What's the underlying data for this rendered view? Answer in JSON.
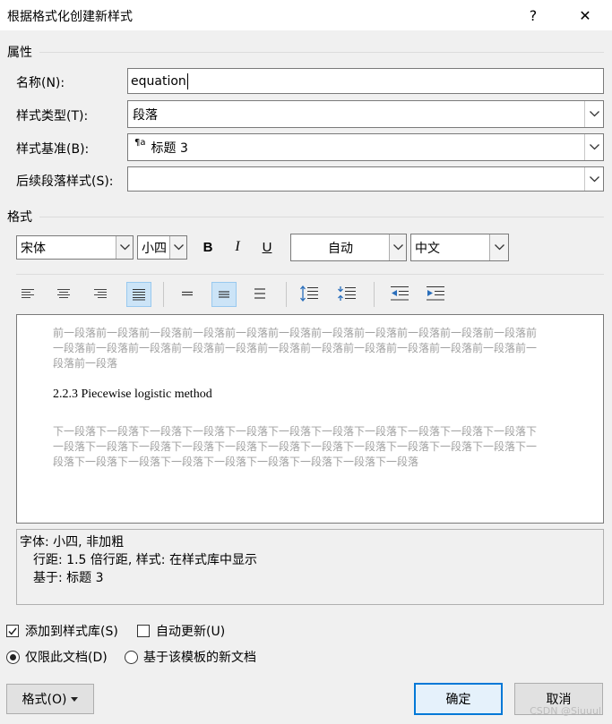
{
  "window": {
    "title": "根据格式化创建新样式",
    "help": "?",
    "close": "✕"
  },
  "properties": {
    "section_label": "属性",
    "name": {
      "label": "名称(N):",
      "value": "equation"
    },
    "style_type": {
      "label": "样式类型(T):",
      "value": "段落"
    },
    "style_based": {
      "label": "样式基准(B):",
      "value": "标题 3",
      "icon_text": "¶a"
    },
    "next_style": {
      "label": "后续段落样式(S):",
      "value": ""
    }
  },
  "format": {
    "section_label": "格式",
    "font": "宋体",
    "size": "小四",
    "bold": "B",
    "italic": "I",
    "underline": "U",
    "color": "自动",
    "script": "中文"
  },
  "preview": {
    "prev_para": "前一段落前一段落前一段落前一段落前一段落前一段落前一段落前一段落前一段落前一段落前一段落前一段落前一段落前一段落前一段落前一段落前一段落前一段落前一段落前一段落前一段落前一段落前一段落前一段落",
    "sample": "2.2.3 Piecewise logistic method",
    "next_para": "下一段落下一段落下一段落下一段落下一段落下一段落下一段落下一段落下一段落下一段落下一段落下一段落下一段落下一段落下一段落下一段落下一段落下一段落下一段落下一段落下一段落下一段落下一段落下一段落下一段落下一段落下一段落下一段落下一段落下一段落下一段落"
  },
  "description": {
    "line1": "字体: 小四, 非加粗",
    "line2": "行距: 1.5 倍行距, 样式: 在样式库中显示",
    "line3": "基于: 标题 3"
  },
  "options": {
    "add_to_gallery": "添加到样式库(S)",
    "add_to_gallery_checked": true,
    "auto_update": "自动更新(U)",
    "auto_update_checked": false,
    "this_doc_only": "仅限此文档(D)",
    "new_docs": "基于该模板的新文档"
  },
  "buttons": {
    "format": "格式(O)",
    "ok": "确定",
    "cancel": "取消"
  },
  "watermark": "CSDN @Siuuul"
}
